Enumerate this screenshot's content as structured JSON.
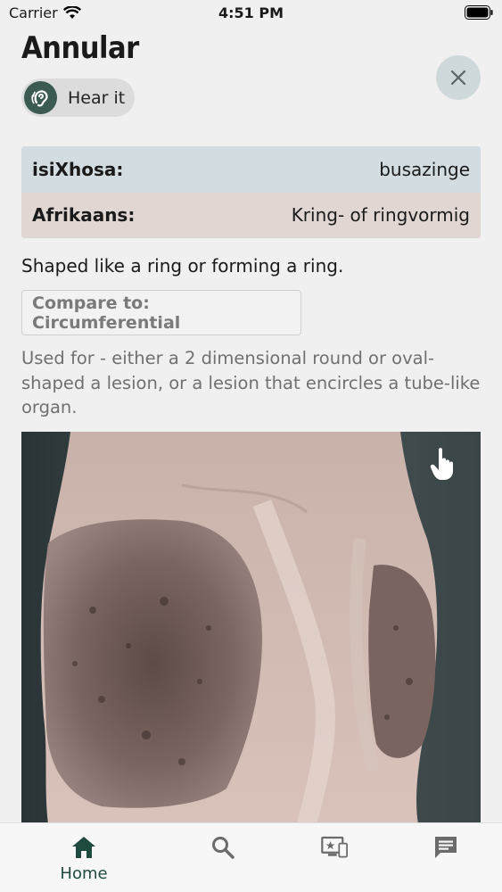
{
  "status_bar": {
    "carrier": "Carrier",
    "time": "4:51 PM"
  },
  "term": {
    "title": "Annular",
    "hear_label": "Hear it"
  },
  "translations": [
    {
      "language": "isiXhosa:",
      "word": "busazinge"
    },
    {
      "language": "Afrikaans:",
      "word": "Kring- of ringvormig"
    }
  ],
  "definition": "Shaped like a ring or forming a ring.",
  "compare_label": "Compare to: Circumferential",
  "usage": "Used for - either a 2 dimensional round or oval-shaped a lesion, or a lesion that encircles a tube-like organ.",
  "tabs": [
    {
      "label": "Home",
      "icon": "home-icon",
      "active": true
    },
    {
      "label": "",
      "icon": "search-icon",
      "active": false
    },
    {
      "label": "",
      "icon": "screen-cast-icon",
      "active": false
    },
    {
      "label": "",
      "icon": "chat-icon",
      "active": false
    }
  ],
  "colors": {
    "accent": "#3b5a52",
    "xhosa_row": "#d3dde1",
    "afrikaans_row": "#e1d7d2",
    "tab_active": "#1f4a40",
    "tab_inactive": "#6b6b6b"
  }
}
